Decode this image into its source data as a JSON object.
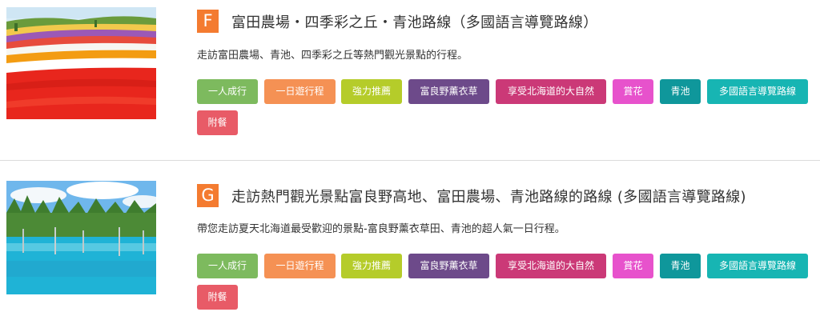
{
  "colors": {
    "letter_badge": "#f47b30",
    "divider": "#dcdcdc"
  },
  "tours": [
    {
      "letter": "F",
      "title": "富田農場・四季彩之丘・青池路線（多國語言導覽路線）",
      "description": "走訪富田農場、青池、四季彩之丘等熱門觀光景點的行程。",
      "image": "flower-field-photo",
      "tags": [
        {
          "label": "一人成行",
          "color": "#7dba5e"
        },
        {
          "label": "一日遊行程",
          "color": "#f59154"
        },
        {
          "label": "強力推薦",
          "color": "#b5cc2a"
        },
        {
          "label": "富良野薰衣草",
          "color": "#6d4a8a"
        },
        {
          "label": "享受北海道的大自然",
          "color": "#cb3977"
        },
        {
          "label": "賞花",
          "color": "#e752cc"
        },
        {
          "label": "青池",
          "color": "#0f979b"
        },
        {
          "label": "多國語言導覽路線",
          "color": "#17b5b3"
        },
        {
          "label": "附餐",
          "color": "#e85b67"
        }
      ]
    },
    {
      "letter": "G",
      "title": "走訪熱門觀光景點富良野高地、富田農場、青池路線的路線 (多國語言導覽路線)",
      "description": "帶您走訪夏天北海道最受歡迎的景點-富良野薰衣草田、青池的超人氣一日行程。",
      "image": "blue-pond-photo",
      "tags": [
        {
          "label": "一人成行",
          "color": "#7dba5e"
        },
        {
          "label": "一日遊行程",
          "color": "#f59154"
        },
        {
          "label": "強力推薦",
          "color": "#b5cc2a"
        },
        {
          "label": "富良野薰衣草",
          "color": "#6d4a8a"
        },
        {
          "label": "享受北海道的大自然",
          "color": "#cb3977"
        },
        {
          "label": "賞花",
          "color": "#e752cc"
        },
        {
          "label": "青池",
          "color": "#0f979b"
        },
        {
          "label": "多國語言導覽路線",
          "color": "#17b5b3"
        },
        {
          "label": "附餐",
          "color": "#e85b67"
        }
      ]
    }
  ]
}
